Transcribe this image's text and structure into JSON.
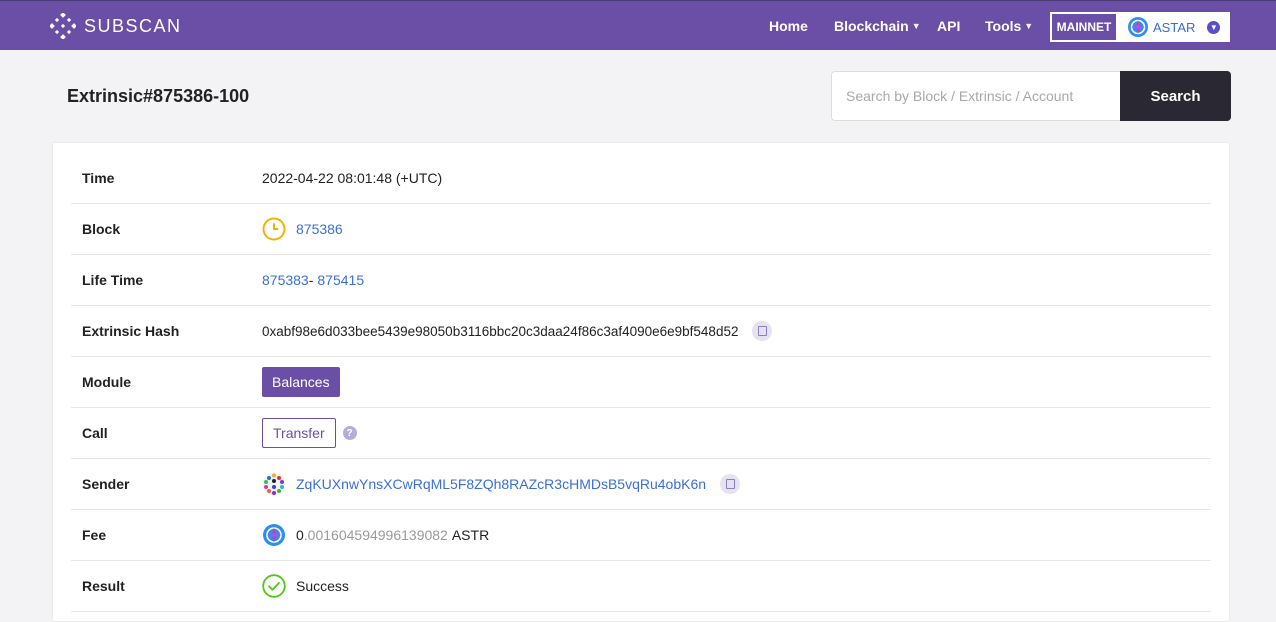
{
  "brand": {
    "name": "SUBSCAN"
  },
  "nav": [
    {
      "label": "Home",
      "has_dropdown": false
    },
    {
      "label": "Blockchain",
      "has_dropdown": true
    },
    {
      "label": "API",
      "has_dropdown": false
    },
    {
      "label": "Tools",
      "has_dropdown": true
    }
  ],
  "network": {
    "type": "MAINNET",
    "chain": "ASTAR"
  },
  "page_title": "Extrinsic#875386-100",
  "search": {
    "placeholder": "Search by Block / Extrinsic / Account",
    "button_label": "Search"
  },
  "details": {
    "time": {
      "label": "Time",
      "value": "2022-04-22 08:01:48 (+UTC)"
    },
    "block": {
      "label": "Block",
      "value": "875386"
    },
    "life_time": {
      "label": "Life Time",
      "start": "875383",
      "separator": "-",
      "end": "875415"
    },
    "extrinsic_hash": {
      "label": "Extrinsic Hash",
      "value": "0xabf98e6d033bee5439e98050b3116bbc20c3daa24f86c3af4090e6e9bf548d52"
    },
    "module": {
      "label": "Module",
      "value": "Balances"
    },
    "call": {
      "label": "Call",
      "value": "Transfer"
    },
    "sender": {
      "label": "Sender",
      "value": "ZqKUXnwYnsXCwRqML5F8ZQh8RAZcR3cHMDsB5vqRu4obK6n"
    },
    "fee": {
      "label": "Fee",
      "integer": "0",
      "decimals": ".001604594996139082",
      "unit": "ASTR"
    },
    "result": {
      "label": "Result",
      "value": "Success"
    }
  },
  "colors": {
    "brand": "#6b4fa6",
    "link": "#3b6fd4",
    "success": "#52c41a",
    "block_icon": "#f0b400"
  }
}
